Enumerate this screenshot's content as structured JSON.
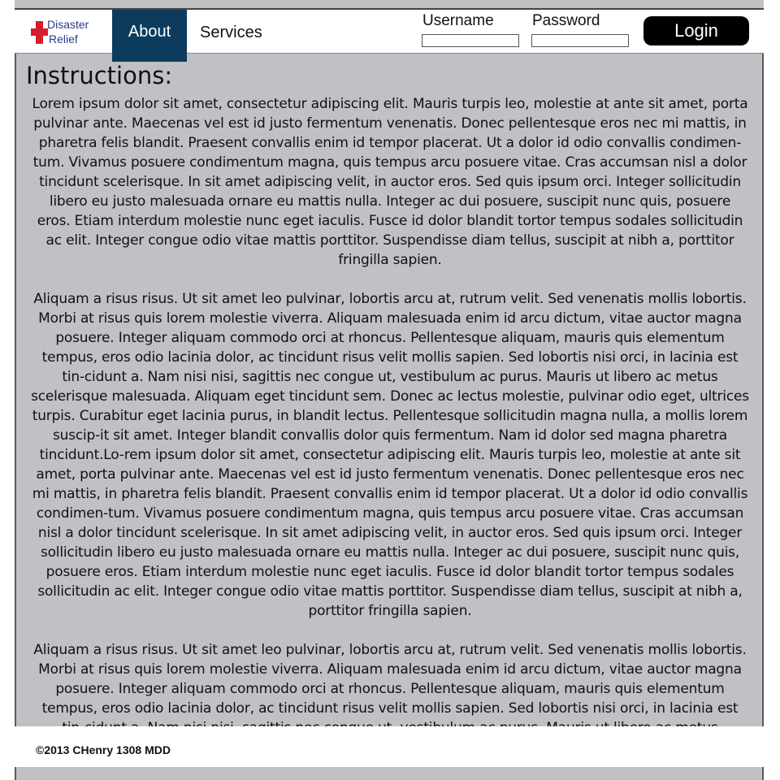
{
  "header": {
    "logo": {
      "line1": "Disaster",
      "line2": "Relief"
    },
    "nav": {
      "about": "About",
      "services": "Services"
    },
    "login": {
      "username_label": "Username",
      "password_label": "Password",
      "username_value": "",
      "password_value": "",
      "button": "Login"
    }
  },
  "main": {
    "title": "Instructions:",
    "paragraphs": [
      "Lorem ipsum dolor sit amet, consectetur adipiscing elit. Mauris turpis leo, molestie at ante sit amet, porta pulvinar ante. Maecenas vel est id justo fermentum venenatis. Donec pellentesque eros nec mi mattis, in pharetra felis blandit. Praesent convallis enim id tempor placerat. Ut a dolor id odio convallis condimen-tum. Vivamus posuere condimentum magna, quis tempus arcu posuere vitae. Cras accumsan nisl a dolor tincidunt scelerisque. In sit amet adipiscing velit, in auctor eros. Sed quis ipsum orci. Integer sollicitudin libero eu justo malesuada ornare eu mattis nulla. Integer ac dui posuere, suscipit nunc quis, posuere eros. Etiam interdum molestie nunc eget iaculis. Fusce id dolor blandit tortor tempus sodales sollicitudin ac elit. Integer congue odio vitae mattis porttitor. Suspendisse diam tellus, suscipit at nibh a, porttitor fringilla sapien.",
      "Aliquam a risus risus. Ut sit amet leo pulvinar, lobortis arcu at, rutrum velit. Sed venenatis mollis lobortis. Morbi at risus quis lorem molestie viverra. Aliquam malesuada enim id arcu dictum, vitae auctor magna posuere. Integer aliquam commodo orci at rhoncus. Pellentesque aliquam, mauris quis elementum tempus, eros odio lacinia dolor, ac tincidunt risus velit mollis sapien. Sed lobortis nisi orci, in lacinia est tin-cidunt a. Nam nisi nisi, sagittis nec congue ut, vestibulum ac purus. Mauris ut libero ac metus scelerisque malesuada. Aliquam eget tincidunt sem. Donec ac lectus molestie, pulvinar odio eget, ultrices turpis. Curabitur eget lacinia purus, in blandit lectus. Pellentesque sollicitudin magna nulla, a mollis lorem suscip-it sit amet. Integer blandit convallis dolor quis fermentum. Nam id dolor sed magna pharetra tincidunt.Lo-rem ipsum dolor sit amet, consectetur adipiscing elit. Mauris turpis leo, molestie at ante sit amet, porta pulvinar ante. Maecenas vel est id justo fermentum venenatis. Donec pellentesque eros nec mi mattis, in pharetra felis blandit. Praesent convallis enim id tempor placerat. Ut a dolor id odio convallis condimen-tum. Vivamus posuere condimentum magna, quis tempus arcu posuere vitae. Cras accumsan nisl a dolor tincidunt scelerisque. In sit amet adipiscing velit, in auctor eros. Sed quis ipsum orci. Integer sollicitudin libero eu justo malesuada ornare eu mattis nulla. Integer ac dui posuere, suscipit nunc quis, posuere eros. Etiam interdum molestie nunc eget iaculis. Fusce id dolor blandit tortor tempus sodales sollicitudin ac elit. Integer congue odio vitae mattis porttitor. Suspendisse diam tellus, suscipit at nibh a, porttitor fringilla sapien.",
      "Aliquam a risus risus. Ut sit amet leo pulvinar, lobortis arcu at, rutrum velit. Sed venenatis mollis lobortis. Morbi at risus quis lorem molestie viverra. Aliquam malesuada enim id arcu dictum, vitae auctor magna posuere. Integer aliquam commodo orci at rhoncus. Pellentesque aliquam, mauris quis elementum tempus, eros odio lacinia dolor, ac tincidunt risus velit mollis sapien. Sed lobortis nisi orci, in lacinia est tin-cidunt a. Nam nisi nisi, sagittis nec congue ut, vestibulum ac purus. Mauris ut libero ac metus scelerisque"
    ]
  },
  "footer": {
    "copyright": "©2013 CHenry 1308 MDD"
  },
  "colors": {
    "nav_active_bg": "#0d3b5e",
    "content_bg": "#c0c1c4",
    "logo_red": "#d41f2a",
    "login_button_bg": "#000000"
  }
}
